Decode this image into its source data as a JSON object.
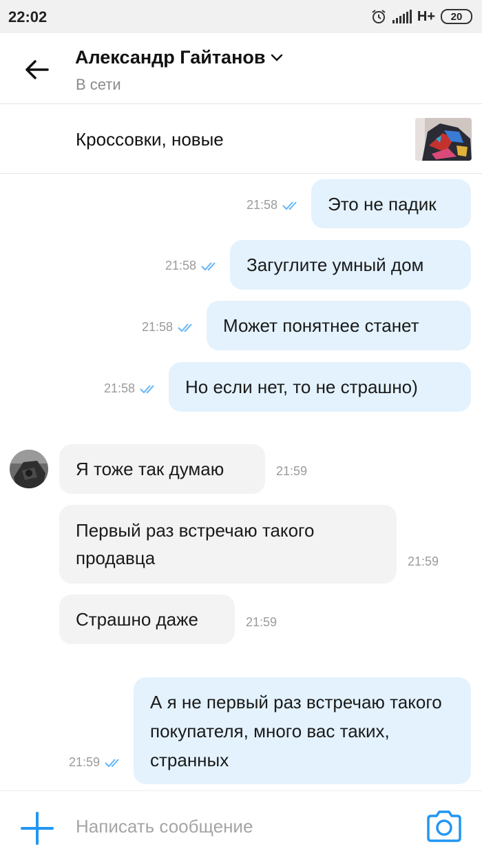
{
  "status_bar": {
    "time": "22:02",
    "network": "H+",
    "battery": "20",
    "icons": [
      "alarm-icon",
      "signal-icon",
      "battery-icon"
    ]
  },
  "header": {
    "contact_name": "Александр Гайтанов",
    "contact_status": "В сети",
    "icons": [
      "back-arrow-icon",
      "chevron-down-icon"
    ]
  },
  "product": {
    "title": "Кроссовки, новые"
  },
  "messages": [
    {
      "direction": "outgoing",
      "text": "Это не падик",
      "time": "21:58",
      "read": true
    },
    {
      "direction": "outgoing",
      "text": "Загуглите умный дом",
      "time": "21:58",
      "read": true
    },
    {
      "direction": "outgoing",
      "text": "Может понятнее станет",
      "time": "21:58",
      "read": true
    },
    {
      "direction": "outgoing",
      "text": "Но если нет, то не страшно)",
      "time": "21:58",
      "read": true
    },
    {
      "direction": "incoming",
      "text": "Я тоже так думаю",
      "time": "21:59"
    },
    {
      "direction": "incoming",
      "text": "Первый раз встречаю такого продавца",
      "time": "21:59"
    },
    {
      "direction": "incoming",
      "text": "Страшно даже",
      "time": "21:59"
    },
    {
      "direction": "outgoing",
      "text": "А я не первый раз встречаю такого покупателя, много вас таких, странных",
      "time": "21:59",
      "read": true
    }
  ],
  "composer": {
    "placeholder": "Написать сообщение",
    "icons": [
      "plus-icon",
      "camera-icon"
    ]
  },
  "colors": {
    "accent": "#2196f3",
    "outgoing_bubble": "#e3f2fd",
    "incoming_bubble": "#f3f3f3",
    "read_ticks": "#64b5f6"
  }
}
